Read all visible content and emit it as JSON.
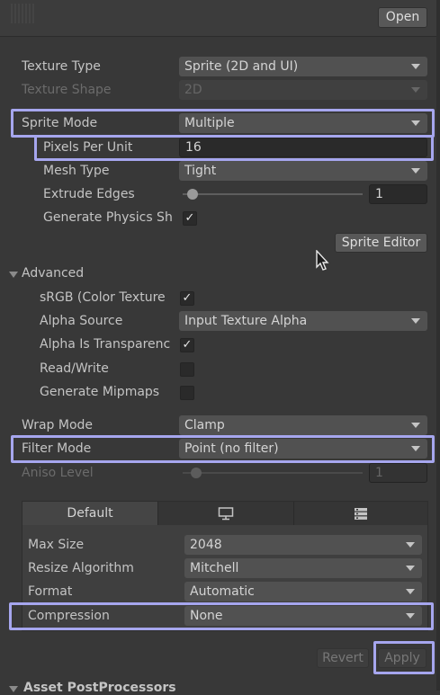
{
  "header": {
    "open_button": "Open"
  },
  "texture_type": {
    "label": "Texture Type",
    "value": "Sprite (2D and UI)"
  },
  "texture_shape": {
    "label": "Texture Shape",
    "value": "2D"
  },
  "sprite_mode": {
    "label": "Sprite Mode",
    "value": "Multiple"
  },
  "pixels_per_unit": {
    "label": "Pixels Per Unit",
    "value": "16"
  },
  "mesh_type": {
    "label": "Mesh Type",
    "value": "Tight"
  },
  "extrude_edges": {
    "label": "Extrude Edges",
    "value": "1"
  },
  "generate_physics_shape": {
    "label": "Generate Physics Sh",
    "checked": true
  },
  "sprite_editor_button": "Sprite Editor",
  "advanced": {
    "label": "Advanced",
    "srgb": {
      "label": "sRGB (Color Texture",
      "checked": true
    },
    "alpha_source": {
      "label": "Alpha Source",
      "value": "Input Texture Alpha"
    },
    "alpha_is_transparency": {
      "label": "Alpha Is Transparenc",
      "checked": true
    },
    "read_write": {
      "label": "Read/Write",
      "checked": false
    },
    "generate_mipmaps": {
      "label": "Generate Mipmaps",
      "checked": false
    }
  },
  "wrap_mode": {
    "label": "Wrap Mode",
    "value": "Clamp"
  },
  "filter_mode": {
    "label": "Filter Mode",
    "value": "Point (no filter)"
  },
  "aniso_level": {
    "label": "Aniso Level",
    "value": "1"
  },
  "platform": {
    "tabs": [
      "Default",
      "monitor-icon",
      "server-icon"
    ],
    "default_label": "Default",
    "max_size": {
      "label": "Max Size",
      "value": "2048"
    },
    "resize_algorithm": {
      "label": "Resize Algorithm",
      "value": "Mitchell"
    },
    "format": {
      "label": "Format",
      "value": "Automatic"
    },
    "compression": {
      "label": "Compression",
      "value": "None"
    }
  },
  "footer": {
    "revert": "Revert",
    "apply": "Apply",
    "asset_postprocessors": "Asset PostProcessors"
  },
  "colors": {
    "highlight": "#a6a6ee",
    "background": "#383838"
  }
}
